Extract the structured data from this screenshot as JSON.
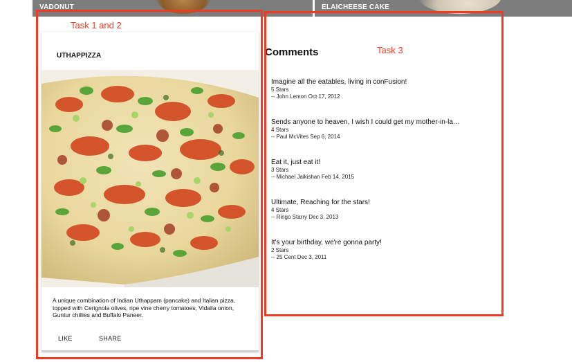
{
  "top_tiles": [
    {
      "label": "VADONUT"
    },
    {
      "label": "ELAICHEESE CAKE"
    }
  ],
  "annotations": {
    "task12": "Task 1 and 2",
    "task3": "Task 3"
  },
  "card": {
    "title": "UTHAPPIZZA",
    "image_alt": "Uthappizza",
    "description": "A unique combination of Indian Uthappam (pancake) and Italian pizza, topped with Cerignola olives, ripe vine cherry tomatoes, Vidalia onion, Guntur chillies and Buffalo Paneer.",
    "like_label": "LIKE",
    "share_label": "SHARE"
  },
  "comments": {
    "heading": "Comments",
    "items": [
      {
        "text": "Imagine all the eatables, living in conFusion!",
        "stars": "5 Stars",
        "author": "-- John Lemon Oct 17, 2012"
      },
      {
        "text": "Sends anyone to heaven, I wish I could get my mother-in-la…",
        "stars": "4 Stars",
        "author": "-- Paul McVites Sep 6, 2014"
      },
      {
        "text": "Eat it, just eat it!",
        "stars": "3 Stars",
        "author": "-- Michael Jaikishan Feb 14, 2015"
      },
      {
        "text": "Ultimate, Reaching for the stars!",
        "stars": "4 Stars",
        "author": "-- Ringo Starry Dec 3, 2013"
      },
      {
        "text": "It's your birthday, we're gonna party!",
        "stars": "2 Stars",
        "author": "-- 25 Cent Dec 3, 2011"
      }
    ]
  },
  "colors": {
    "annotation": "#ef3b24",
    "tile_bg": "#7d7d7d"
  }
}
